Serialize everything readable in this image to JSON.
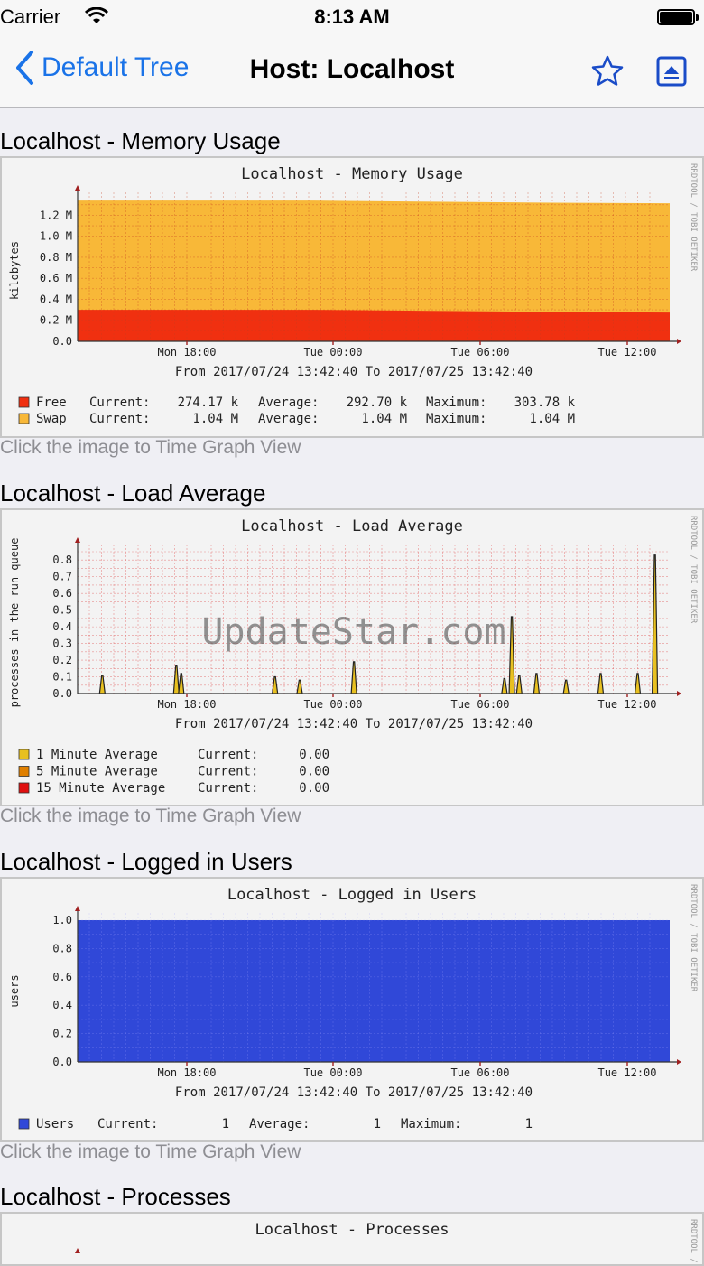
{
  "status": {
    "carrier": "Carrier",
    "time": "8:13 AM"
  },
  "nav": {
    "back_label": "Default Tree",
    "title": "Host: Localhost"
  },
  "caption_text": "Click the image to Time Graph View",
  "watermark": "UpdateStar.com",
  "rrd_side": "RRDTOOL / TOBI OETIKER",
  "x_axis": {
    "ticks": [
      "Mon 18:00",
      "Tue 00:00",
      "Tue 06:00",
      "Tue 12:00"
    ],
    "range_text": "From 2017/07/24 13:42:40 To 2017/07/25 13:42:40"
  },
  "graphs": [
    {
      "section_title": "Localhost - Memory Usage",
      "title": "Localhost - Memory Usage",
      "ylabel": "kilobytes",
      "yticks": [
        "0.0",
        "0.2 M",
        "0.4 M",
        "0.6 M",
        "0.8 M",
        "1.0 M",
        "1.2 M"
      ],
      "legend": [
        {
          "color": "#f03010",
          "label": "Free",
          "c_label": "Current:",
          "c_val": "274.17 k",
          "a_label": "Average:",
          "a_val": "292.70 k",
          "m_label": "Maximum:",
          "m_val": "303.78 k"
        },
        {
          "color": "#f8b838",
          "label": "Swap",
          "c_label": "Current:",
          "c_val": "1.04 M",
          "a_label": "Average:",
          "a_val": "1.04 M",
          "m_label": "Maximum:",
          "m_val": "1.04 M"
        }
      ]
    },
    {
      "section_title": "Localhost - Load Average",
      "title": "Localhost - Load Average",
      "ylabel": "processes in the run queue",
      "yticks": [
        "0.0",
        "0.1",
        "0.2",
        "0.3",
        "0.4",
        "0.5",
        "0.6",
        "0.7",
        "0.8"
      ],
      "legend": [
        {
          "color": "#e8c020",
          "label": "1 Minute Average",
          "c_label": "Current:",
          "c_val": "0.00"
        },
        {
          "color": "#e08000",
          "label": "5 Minute Average",
          "c_label": "Current:",
          "c_val": "0.00"
        },
        {
          "color": "#e01010",
          "label": "15 Minute Average",
          "c_label": "Current:",
          "c_val": "0.00"
        }
      ]
    },
    {
      "section_title": "Localhost - Logged in Users",
      "title": "Localhost - Logged in Users",
      "ylabel": "users",
      "yticks": [
        "0.0",
        "0.2",
        "0.4",
        "0.6",
        "0.8",
        "1.0"
      ],
      "legend": [
        {
          "color": "#3048d8",
          "label": "Users",
          "c_label": "Current:",
          "c_val": "1",
          "a_label": "Average:",
          "a_val": "1",
          "m_label": "Maximum:",
          "m_val": "1"
        }
      ]
    },
    {
      "section_title": "Localhost - Processes",
      "title": "Localhost - Processes"
    }
  ],
  "chart_data": [
    {
      "type": "area",
      "title": "Localhost - Memory Usage",
      "ylabel": "kilobytes",
      "ylim": [
        0,
        1.35
      ],
      "unit": "M",
      "x": [
        "13:42",
        "18:00",
        "00:00",
        "06:00",
        "12:00",
        "13:42"
      ],
      "series": [
        {
          "name": "Free",
          "color": "#f03010",
          "values": [
            0.3,
            0.3,
            0.3,
            0.29,
            0.28,
            0.274
          ]
        },
        {
          "name": "Swap",
          "color": "#f8b838",
          "values": [
            1.04,
            1.04,
            1.04,
            1.04,
            1.04,
            1.04
          ]
        }
      ],
      "grid": true
    },
    {
      "type": "area",
      "title": "Localhost - Load Average",
      "ylabel": "processes in the run queue",
      "ylim": [
        0,
        0.85
      ],
      "spikes_x_hours": [
        1.0,
        4.0,
        4.2,
        8.0,
        9.0,
        11.2,
        17.3,
        17.6,
        17.9,
        18.6,
        19.8,
        21.2,
        22.7,
        23.4
      ],
      "spikes_y": [
        0.11,
        0.17,
        0.12,
        0.1,
        0.08,
        0.19,
        0.09,
        0.46,
        0.11,
        0.12,
        0.08,
        0.12,
        0.12,
        0.83
      ],
      "series": [
        {
          "name": "1 Minute Average",
          "color": "#e8c020"
        },
        {
          "name": "5 Minute Average",
          "color": "#e08000"
        },
        {
          "name": "15 Minute Average",
          "color": "#e01010"
        }
      ],
      "grid": true
    },
    {
      "type": "area",
      "title": "Localhost - Logged in Users",
      "ylabel": "users",
      "ylim": [
        0,
        1.0
      ],
      "series": [
        {
          "name": "Users",
          "color": "#3048d8",
          "values": [
            1,
            1,
            1,
            1,
            1,
            1
          ]
        }
      ],
      "grid": true
    }
  ]
}
